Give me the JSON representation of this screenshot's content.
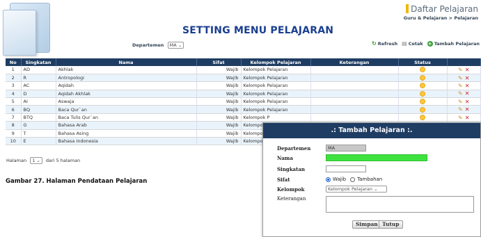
{
  "header": {
    "app_title": "Daftar Pelajaran",
    "breadcrumb": "Guru & Pelajaran > Pelajaran",
    "page_title": "SETTING MENU PELAJARAN"
  },
  "filter": {
    "label": "Departemen",
    "value": "MA"
  },
  "toolbar": {
    "refresh": "Refresh",
    "print": "Cetak",
    "add": "Tambah Pelajaran"
  },
  "table": {
    "columns": [
      "No",
      "Singkatan",
      "Nama",
      "Sifat",
      "Kelompok Pelajaran",
      "Keterangan",
      "Status",
      ""
    ],
    "rows": [
      [
        "1",
        "AD",
        "Akhlak",
        "Wajib",
        "Kelompok Pelajaran",
        ""
      ],
      [
        "2",
        "R",
        "Antropologi",
        "Wajib",
        "Kelompok Pelajaran",
        ""
      ],
      [
        "3",
        "AC",
        "Aqidah",
        "Wajib",
        "Kelompok Pelajaran",
        ""
      ],
      [
        "4",
        "D",
        "Aqidah Akhlak",
        "Wajib",
        "Kelompok Pelajaran",
        ""
      ],
      [
        "5",
        "AI",
        "Aswaja",
        "Wajib",
        "Kelompok Pelajaran",
        ""
      ],
      [
        "6",
        "BQ",
        "Baca Qur`an",
        "Wajib",
        "Kelompok Pelajaran",
        ""
      ],
      [
        "7",
        "BTQ",
        "Baca Tulis Qur`an",
        "Wajib",
        "Kelompok P",
        ""
      ],
      [
        "8",
        "G",
        "Bahasa Arab",
        "Wajib",
        "Kelompok P",
        ""
      ],
      [
        "9",
        "T",
        "Bahasa Asing",
        "Wajib",
        "Kelompok P",
        ""
      ],
      [
        "10",
        "E",
        "Bahasa Indonesia",
        "Wajib",
        "Kelompok P",
        ""
      ]
    ]
  },
  "pager": {
    "label": "Halaman",
    "value": "1",
    "suffix": "dari 5 halaman"
  },
  "caption": "Gambar 27. Halaman Pendataan Pelajaran",
  "dialog": {
    "title": ".: Tambah Pelajaran :.",
    "departemen_label": "Departemen",
    "departemen_value": "MA",
    "nama_label": "Nama",
    "singkatan_label": "Singkatan",
    "sifat_label": "Sifat",
    "sifat_options": [
      "Wajib",
      "Tambahan"
    ],
    "kelompok_label": "Kelompok",
    "kelompok_value": "Kelompok Pelajaran",
    "keterangan_label": "Keterangan",
    "save": "Simpan",
    "close": "Tutup"
  },
  "colors": {
    "header_bg": "#1f3d63",
    "title": "#1a3f8f",
    "highlight": "#3ee23e",
    "status": "#ffc83d"
  }
}
